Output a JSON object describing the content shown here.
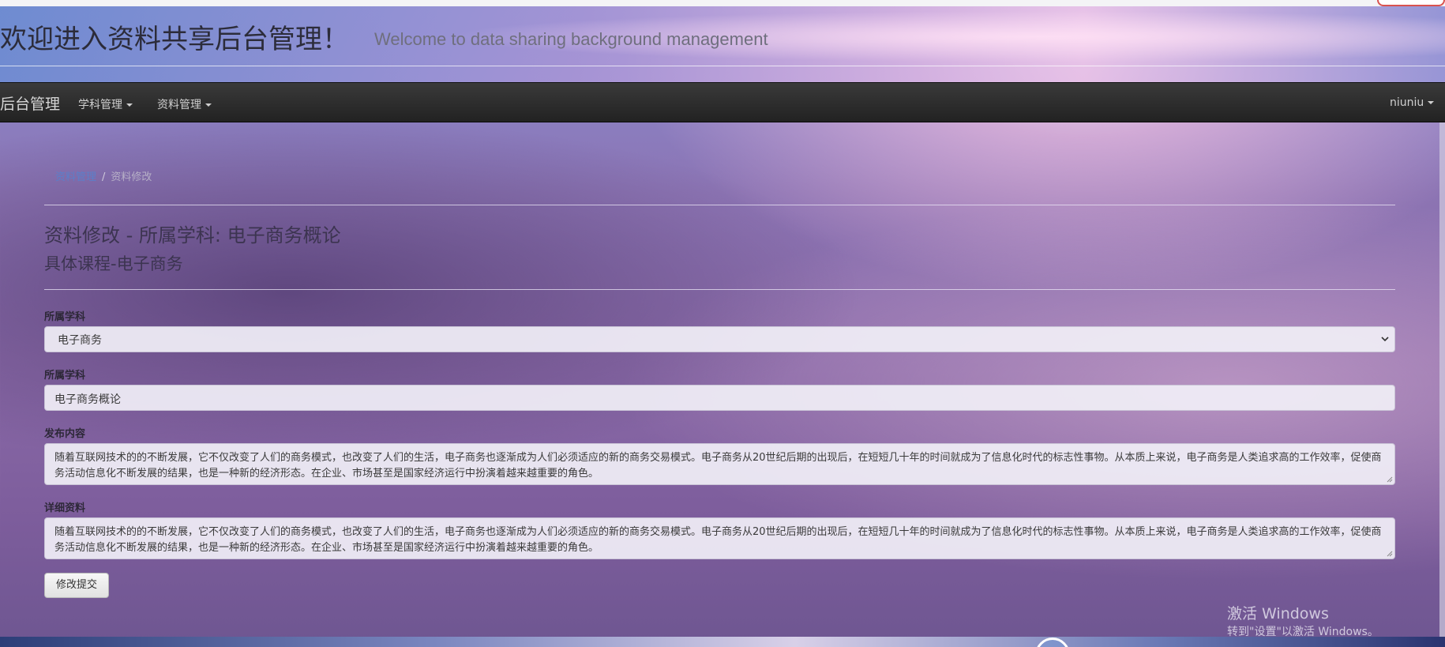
{
  "header": {
    "title_cn": "欢迎进入资料共享后台管理！",
    "title_en": "Welcome to data sharing background management"
  },
  "navbar": {
    "brand": "后台管理",
    "items": [
      {
        "label": "学科管理"
      },
      {
        "label": "资料管理"
      }
    ],
    "user": "niuniu"
  },
  "breadcrumb": {
    "parent": "资料管理",
    "separator": "/",
    "current": "资料修改"
  },
  "page": {
    "title": "资料修改 - 所属学科: 电子商务概论",
    "subtitle": "具体课程-电子商务"
  },
  "form": {
    "subject_label": "所属学科",
    "subject_value": "电子商务",
    "course_label": "所属学科",
    "course_value": "电子商务概论",
    "content_label": "发布内容",
    "content_value": "随着互联网技术的的不断发展，它不仅改变了人们的商务模式，也改变了人们的生活，电子商务也逐渐成为人们必须适应的新的商务交易模式。电子商务从20世纪后期的出现后，在短短几十年的时间就成为了信息化时代的标志性事物。从本质上来说，电子商务是人类追求高的工作效率，促使商务活动信息化不断发展的结果，也是一种新的经济形态。在企业、市场甚至是国家经济运行中扮演着越来越重要的角色。",
    "details_label": "详细资料",
    "details_value": "随着互联网技术的的不断发展，它不仅改变了人们的商务模式，也改变了人们的生活，电子商务也逐渐成为人们必须适应的新的商务交易模式。电子商务从20世纪后期的出现后，在短短几十年的时间就成为了信息化时代的标志性事物。从本质上来说，电子商务是人类追求高的工作效率，促使商务活动信息化不断发展的结果，也是一种新的经济形态。在企业、市场甚至是国家经济运行中扮演着越来越重要的角色。",
    "submit_label": "修改提交"
  },
  "watermark": {
    "line1": "激活 Windows",
    "line2": "转到\"设置\"以激活 Windows。"
  },
  "colors": {
    "navbar_bg": "#222222",
    "breadcrumb_link": "#5b7fc9"
  },
  "icons": {
    "nav_caret": "caret-down-icon",
    "select_chevron": "chevron-down-icon",
    "textarea_grip": "resize-grip-icon"
  }
}
